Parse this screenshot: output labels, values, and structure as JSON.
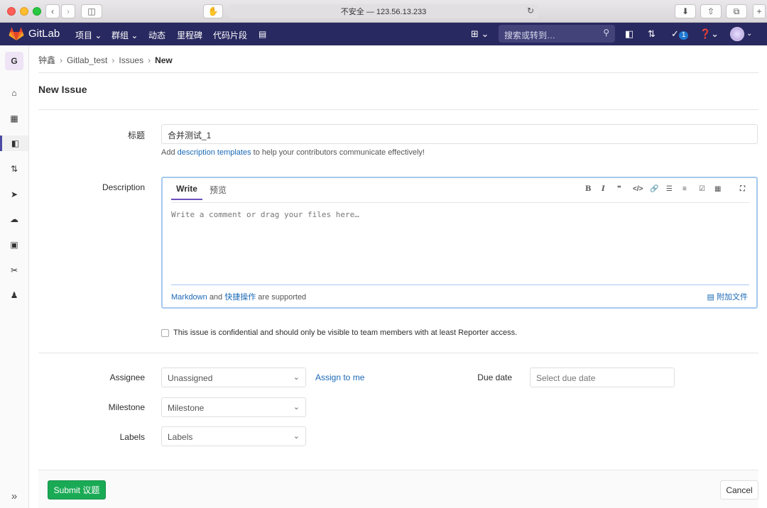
{
  "browser": {
    "url": "不安全 — 123.56.13.233"
  },
  "navbar": {
    "brand": "GitLab",
    "items": [
      "项目",
      "群组",
      "动态",
      "里程碑",
      "代码片段"
    ],
    "search_placeholder": "搜索或转到…",
    "todo_count": "1"
  },
  "sidebar": {
    "project_initial": "G"
  },
  "breadcrumb": [
    "钟鑫",
    "Gitlab_test",
    "Issues",
    "New"
  ],
  "page_title": "New Issue",
  "form": {
    "title_label": "标题",
    "title_value": "合并测试_1",
    "help_prefix": "Add",
    "help_link": "description templates",
    "help_suffix": "to help your contributors communicate effectively!",
    "description_label": "Description",
    "tab_write": "Write",
    "tab_preview": "预览",
    "description_placeholder": "Write a comment or drag your files here…",
    "markdown_link": "Markdown",
    "and": "and",
    "quick_actions_link": "快捷操作",
    "supported": "are supported",
    "attach_file": "附加文件",
    "confidential_text": "This issue is confidential and should only be visible to team members with at least Reporter access.",
    "assignee_label": "Assignee",
    "assignee_value": "Unassigned",
    "assign_to_me": "Assign to me",
    "milestone_label": "Milestone",
    "milestone_value": "Milestone",
    "labels_label": "Labels",
    "labels_value": "Labels",
    "due_date_label": "Due date",
    "due_date_placeholder": "Select due date",
    "submit": "Submit 议题",
    "cancel": "Cancel"
  },
  "colors": {
    "navbar": "#292961",
    "submit": "#1aaa55",
    "link": "#1b69b6",
    "active_tab": "#6b4fbb"
  }
}
